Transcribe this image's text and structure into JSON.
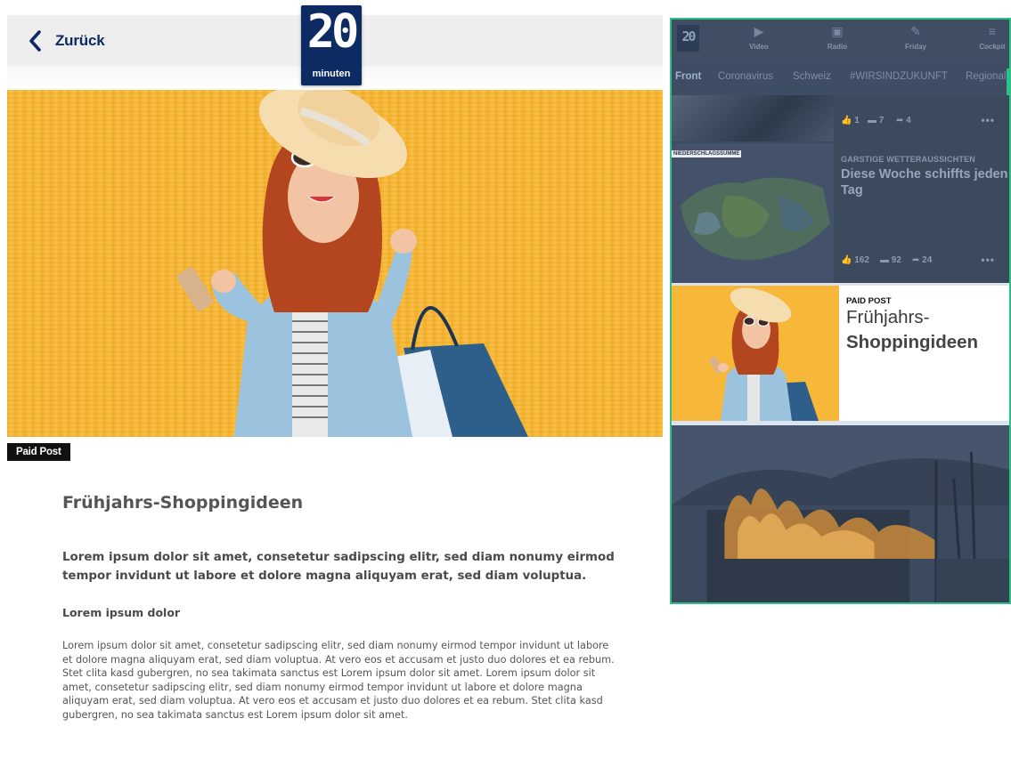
{
  "header": {
    "back_label": "Zurück",
    "logo_number": "20",
    "logo_word": "minuten"
  },
  "article": {
    "badge": "Paid Post",
    "title": "Frühjahrs-Shoppingideen",
    "lead": "Lorem ipsum dolor sit amet, consetetur sadipscing elitr, sed diam nonumy eirmod tempor invidunt ut labore et dolore magna aliquyam erat, sed diam voluptua.",
    "subheading": "Lorem ipsum dolor",
    "body": "Lorem ipsum dolor sit amet, consetetur sadipscing elitr, sed diam nonumy eirmod tempor invidunt ut labore et dolore magna aliquyam erat, sed diam voluptua. At vero eos et accusam et justo duo dolores et ea rebum. Stet clita kasd gubergren, no sea takimata sanctus est Lorem ipsum dolor sit amet. Lorem ipsum dolor sit amet, consetetur sadipscing elitr, sed diam nonumy eirmod tempor invidunt ut labore et dolore magna aliquyam erat, sed diam voluptua. At vero eos et accusam et justo duo dolores et ea rebum. Stet clita kasd gubergren, no sea takimata sanctus est Lorem ipsum dolor sit amet."
  },
  "preview": {
    "nav": {
      "logo": "20",
      "items": [
        "Video",
        "Radio",
        "Friday",
        "Cockpit"
      ],
      "icons": [
        "play-icon",
        "radio-icon",
        "friday-icon",
        "menu-icon"
      ]
    },
    "tabs": [
      "Front",
      "Coronavirus",
      "Schweiz",
      "#WIRSINDZUKUNFT",
      "Regional"
    ],
    "card1": {
      "likes": "1",
      "comments": "7",
      "shares": "4",
      "more": "•••"
    },
    "card2": {
      "map_label": "NIEDERSCHLAGSSUMME",
      "kicker": "GARSTIGE WETTERAUSSICHTEN",
      "headline": "Diese Woche schiffts jeden Tag",
      "likes": "162",
      "comments": "92",
      "shares": "24",
      "more": "•••"
    },
    "paid_card": {
      "kicker": "PAID POST",
      "title_line1": "Frühjahrs-",
      "title_line2": "Shoppingideen"
    }
  },
  "colors": {
    "brand_navy": "#0d2a63",
    "preview_border": "#2fbf87",
    "hero_yellow": "#f7b52f"
  }
}
